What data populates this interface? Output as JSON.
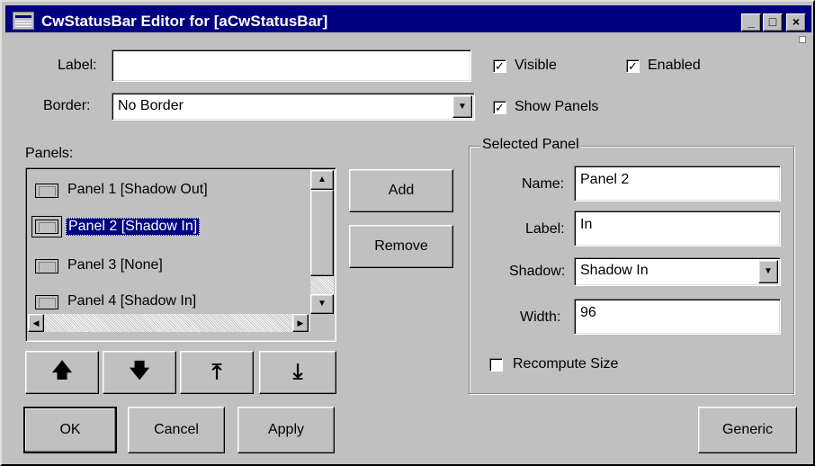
{
  "window": {
    "title": "CwStatusBar Editor for [aCwStatusBar]",
    "minimize": "_",
    "maximize": "□",
    "close": "×"
  },
  "label_field": {
    "label": "Label:",
    "value": ""
  },
  "border_field": {
    "label": "Border:",
    "value": "No Border"
  },
  "checkboxes": {
    "visible": {
      "label": "Visible",
      "checked": true
    },
    "enabled": {
      "label": "Enabled",
      "checked": true
    },
    "show_panels": {
      "label": "Show Panels",
      "checked": true
    },
    "recompute_size": {
      "label": "Recompute Size",
      "checked": false
    }
  },
  "panels": {
    "label": "Panels:",
    "items": [
      {
        "text": "Panel 1 [Shadow Out]",
        "selected": false
      },
      {
        "text": "Panel 2 [Shadow In]",
        "selected": true
      },
      {
        "text": "Panel 3 [None]",
        "selected": false
      },
      {
        "text": "Panel 4 [Shadow In]",
        "selected": false
      }
    ]
  },
  "buttons": {
    "add": "Add",
    "remove": "Remove",
    "ok": "OK",
    "cancel": "Cancel",
    "apply": "Apply",
    "generic": "Generic"
  },
  "move_buttons": {
    "up": "🡅",
    "down": "🡇",
    "top": "⤒",
    "bottom": "⤓"
  },
  "selected_panel": {
    "group_label": "Selected Panel",
    "name": {
      "label": "Name:",
      "value": "Panel 2"
    },
    "label": {
      "label": "Label:",
      "value": "In"
    },
    "shadow": {
      "label": "Shadow:",
      "value": "Shadow In"
    },
    "width": {
      "label": "Width:",
      "value": "96"
    }
  },
  "icons": {
    "system_menu": "system-menu-icon",
    "dropdown": "chevron-down-icon",
    "move_up": "arrow-up-icon",
    "move_down": "arrow-down-icon",
    "move_top": "arrow-top-icon",
    "move_bottom": "arrow-bottom-icon"
  }
}
